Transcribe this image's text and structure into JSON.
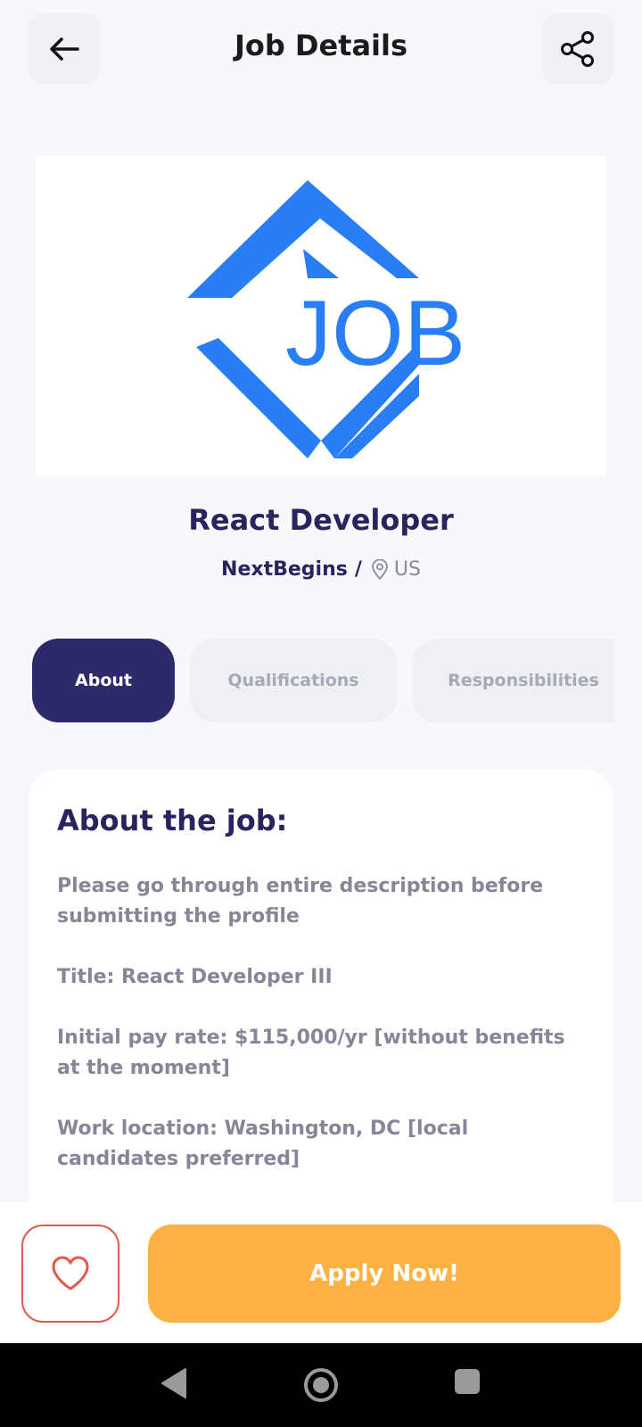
{
  "header": {
    "title": "Job Details",
    "back_icon": "arrow-left-icon",
    "share_icon": "share-icon"
  },
  "logo": {
    "text": "JOB",
    "color": "#2a7ef5"
  },
  "job": {
    "title": "React Developer",
    "company": "NextBegins",
    "separator": "/",
    "location_icon": "map-pin-icon",
    "location": "US"
  },
  "tabs": [
    {
      "label": "About",
      "active": true
    },
    {
      "label": "Qualifications",
      "active": false
    },
    {
      "label": "Responsibilities",
      "active": false
    }
  ],
  "about": {
    "heading": "About the job:",
    "paragraphs": [
      "Please go through entire description before submitting the profile",
      "Title: React Developer III",
      "Initial pay rate: $115,000/yr [without benefits at the moment]",
      "Work location: Washington, DC [local candidates preferred]"
    ]
  },
  "actions": {
    "favorite_icon": "heart-icon",
    "apply_label": "Apply Now!"
  },
  "colors": {
    "primary": "#2c2a6b",
    "accent": "#fcb142",
    "favorite": "#e05a4e"
  },
  "system_nav": [
    "back-triangle-icon",
    "home-circle-icon",
    "recents-square-icon"
  ]
}
